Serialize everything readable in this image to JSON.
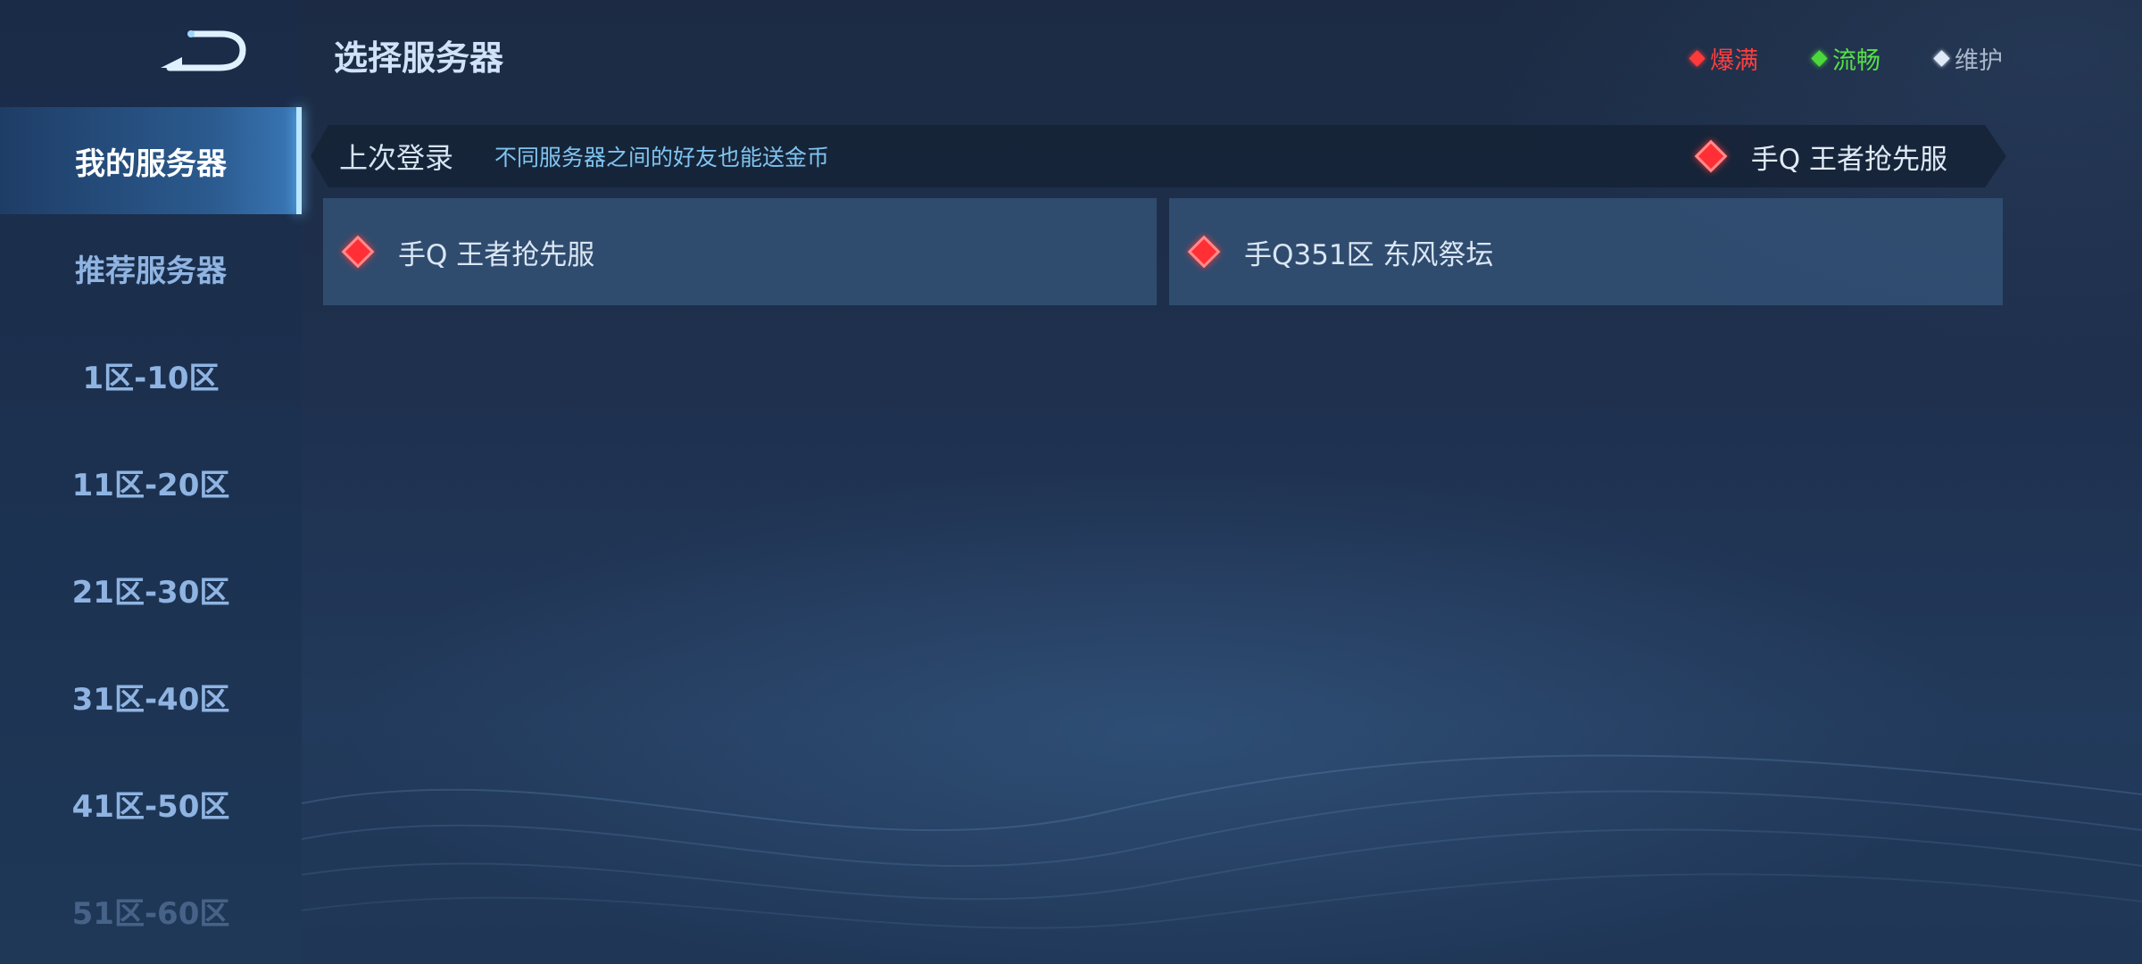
{
  "header": {
    "title": "选择服务器"
  },
  "legend": {
    "full": "爆满",
    "smooth": "流畅",
    "maintenance": "维护"
  },
  "colors": {
    "full": "#ff3a3a",
    "smooth": "#4cd83a",
    "maintenance": "#dfe9f7",
    "accent": "#8ed0ff"
  },
  "sidebar": {
    "items": [
      {
        "label": "我的服务器"
      },
      {
        "label": "推荐服务器"
      },
      {
        "label": "1区-10区"
      },
      {
        "label": "11区-20区"
      },
      {
        "label": "21区-30区"
      },
      {
        "label": "31区-40区"
      },
      {
        "label": "41区-50区"
      },
      {
        "label": "51区-60区"
      }
    ]
  },
  "last_login": {
    "label": "上次登录",
    "tip": "不同服务器之间的好友也能送金币",
    "server": "手Q 王者抢先服"
  },
  "servers": [
    {
      "name": "手Q 王者抢先服"
    },
    {
      "name": "手Q351区 东风祭坛"
    }
  ]
}
